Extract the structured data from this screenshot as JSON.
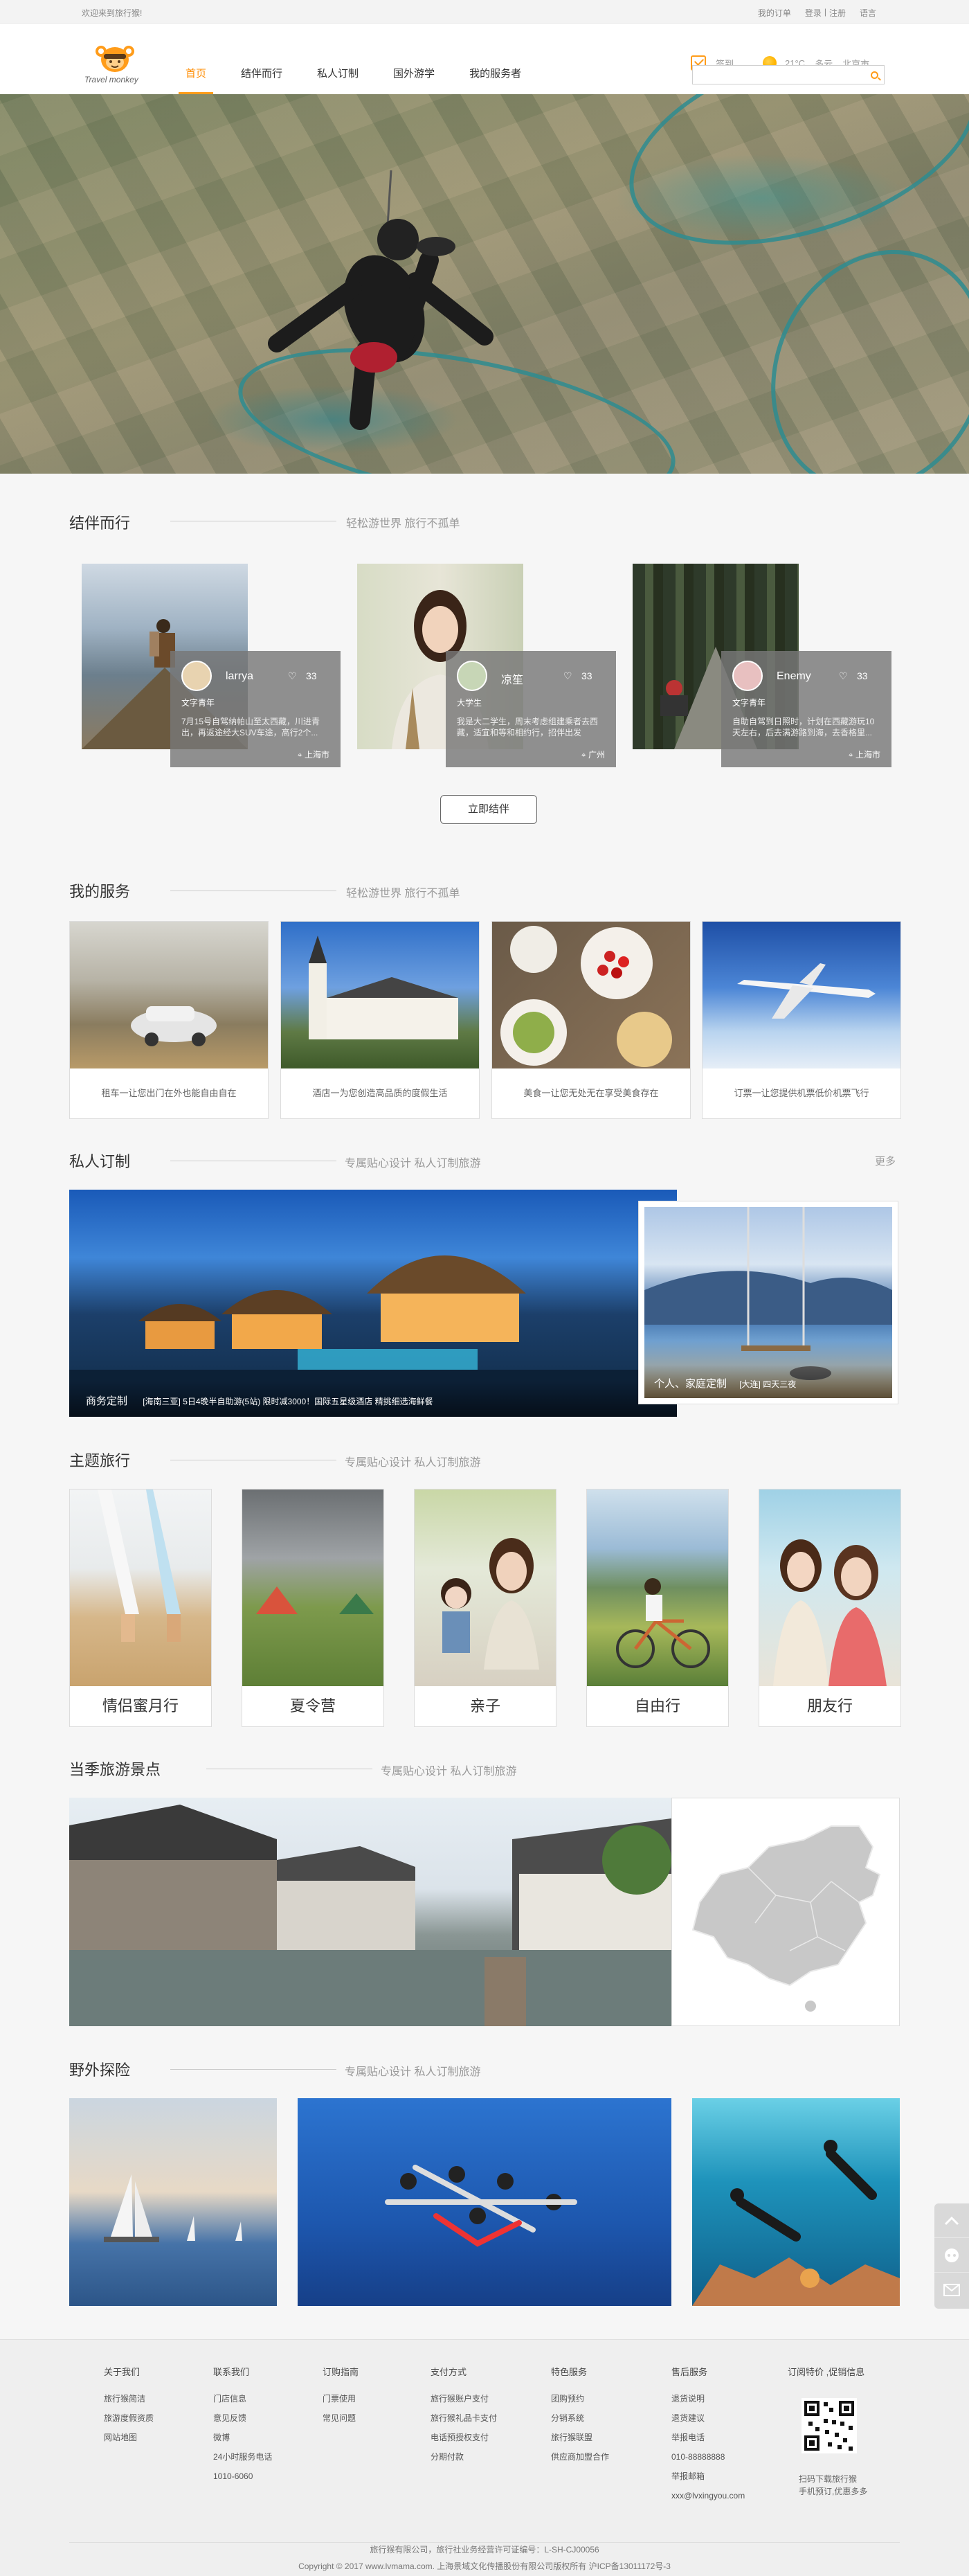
{
  "topbar": {
    "welcome": "欢迎来到旅行猴!",
    "my_orders": "我的订单",
    "login": "登录",
    "sep": "|",
    "register": "注册",
    "language": "语言"
  },
  "header": {
    "logo_text": "Travel monkey",
    "nav": [
      "首页",
      "结伴而行",
      "私人订制",
      "国外游学",
      "我的服务者"
    ],
    "signin": "签到",
    "temperature": "21°C",
    "weather": "多云",
    "city": "北京市",
    "search_placeholder": ""
  },
  "companions": {
    "title": "结伴而行",
    "subtitle": "轻松游世界 旅行不孤单",
    "cards": [
      {
        "name": "larrya",
        "likes": "33",
        "tag": "文字青年",
        "desc": "7月15号自驾纳帕山至太西藏，川进青出，再返途经大SUV车途，高行2个...",
        "location": "上海市"
      },
      {
        "name": "凉笙",
        "likes": "33",
        "tag": "大学生",
        "desc": "我是大二学生，周末考虑组建乘者去西藏，适宜和等和相约行，招伴出发",
        "location": "广州"
      },
      {
        "name": "Enemy",
        "likes": "33",
        "tag": "文字青年",
        "desc": "自助自驾到日照时，计划在西藏游玩10天左右，后去满游路到海，去香格里...",
        "location": "上海市"
      }
    ],
    "button": "立即结伴"
  },
  "services": {
    "title": "我的服务",
    "subtitle": "轻松游世界 旅行不孤单",
    "items": [
      "租车一让您出门在外也能自由自在",
      "酒店一为您创造高品质的度假生活",
      "美食一让您无处无在享受美食存在",
      "订票一让您提供机票低价机票飞行"
    ]
  },
  "private": {
    "title": "私人订制",
    "subtitle": "专属贴心设计 私人订制旅游",
    "more": "更多",
    "main_label": "商务定制",
    "main_desc": "[海南三亚] 5日4晚半自助游(5站) 限时减3000！国际五星级酒店 精挑细选海鲜餐",
    "side_label": "个人、家庭定制",
    "side_desc": "[大连] 四天三夜"
  },
  "themes": {
    "title": "主题旅行",
    "subtitle": "专属贴心设计 私人订制旅游",
    "items": [
      "情侣蜜月行",
      "夏令营",
      "亲子",
      "自由行",
      "朋友行"
    ]
  },
  "season": {
    "title": "当季旅游景点",
    "subtitle": "专属贴心设计 私人订制旅游"
  },
  "outdoor": {
    "title": "野外探险",
    "subtitle": "专属贴心设计 私人订制旅游"
  },
  "footer": {
    "columns": [
      {
        "title": "关于我们",
        "items": [
          "旅行猴简洁",
          "旅游度假资质",
          "网站地图"
        ]
      },
      {
        "title": "联系我们",
        "items": [
          "门店信息",
          "意见反馈",
          "微博",
          "24小时服务电话",
          "1010-6060"
        ]
      },
      {
        "title": "订购指南",
        "items": [
          "门票使用",
          "常见问题"
        ]
      },
      {
        "title": "支付方式",
        "items": [
          "旅行猴账户支付",
          "旅行猴礼品卡支付",
          "电话预授权支付",
          "分期付款"
        ]
      },
      {
        "title": "特色服务",
        "items": [
          "团购预约",
          "分销系统",
          "旅行猴联盟",
          "供应商加盟合作"
        ]
      },
      {
        "title": "售后服务",
        "items": [
          "退货说明",
          "退货建议",
          "举报电话",
          "010-88888888",
          "举报邮箱",
          "xxx@lvxingyou.com"
        ]
      }
    ],
    "app_title": "订阅特价 ,促销信息",
    "app_caption_1": "扫码下载旅行猴",
    "app_caption_2": "手机预订,优惠多多",
    "company": "旅行猴有限公司，旅行社业务经营许可证编号：L-SH-CJ00056",
    "copyright": "Copyright © 2017 www.lvmama.com. 上海景域文化传播股份有限公司版权所有   沪ICP备13011172号-3"
  },
  "colors": {
    "accent": "#ff9c1a",
    "nav_active": "#ff8c00"
  }
}
